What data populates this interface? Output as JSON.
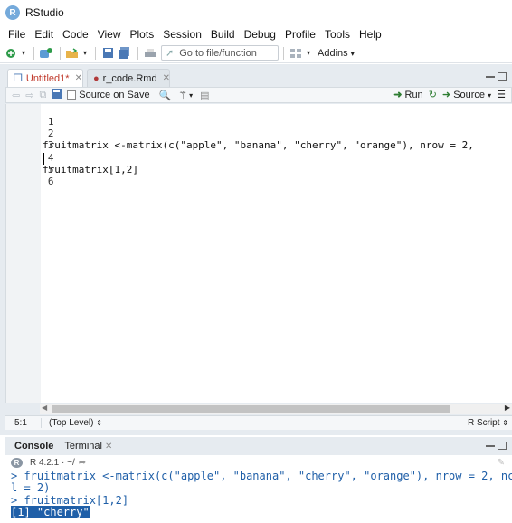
{
  "window": {
    "title": "RStudio",
    "app_icon": "R"
  },
  "menu": [
    "File",
    "Edit",
    "Code",
    "View",
    "Plots",
    "Session",
    "Build",
    "Debug",
    "Profile",
    "Tools",
    "Help"
  ],
  "toolbar": {
    "goto_placeholder": "Go to file/function",
    "addins_label": "Addins"
  },
  "editor_tabs": [
    {
      "label": "Untitled1*",
      "active": true
    },
    {
      "label": "r_code.Rmd",
      "active": false
    }
  ],
  "editor_toolbar": {
    "source_on_save": "Source on Save",
    "run": "Run",
    "source": "Source"
  },
  "editor": {
    "lines": [
      {
        "num": "1",
        "text": ""
      },
      {
        "num": "2",
        "text": "fruitmatrix <-matrix(c(\"apple\", \"banana\", \"cherry\", \"orange\"), nrow = 2,"
      },
      {
        "num": "3",
        "text": ""
      },
      {
        "num": "4",
        "text": "fruitmatrix[1,2]"
      },
      {
        "num": "5",
        "text": ""
      },
      {
        "num": "6",
        "text": ""
      }
    ]
  },
  "status": {
    "position": "5:1",
    "scope": "(Top Level)",
    "filetype": "R Script"
  },
  "console_tabs": [
    "Console",
    "Terminal"
  ],
  "console_info": "R 4.2.1 · ~/",
  "console": {
    "lines": [
      "> fruitmatrix <-matrix(c(\"apple\", \"banana\", \"cherry\", \"orange\"), nrow = 2, nco",
      "l = 2)",
      "> fruitmatrix[1,2]",
      "[1] \"cherry\""
    ]
  },
  "colors": {
    "accent": "#75aadb",
    "pane_bg": "#e6ebf0",
    "console_text": "#1f5fa8"
  }
}
